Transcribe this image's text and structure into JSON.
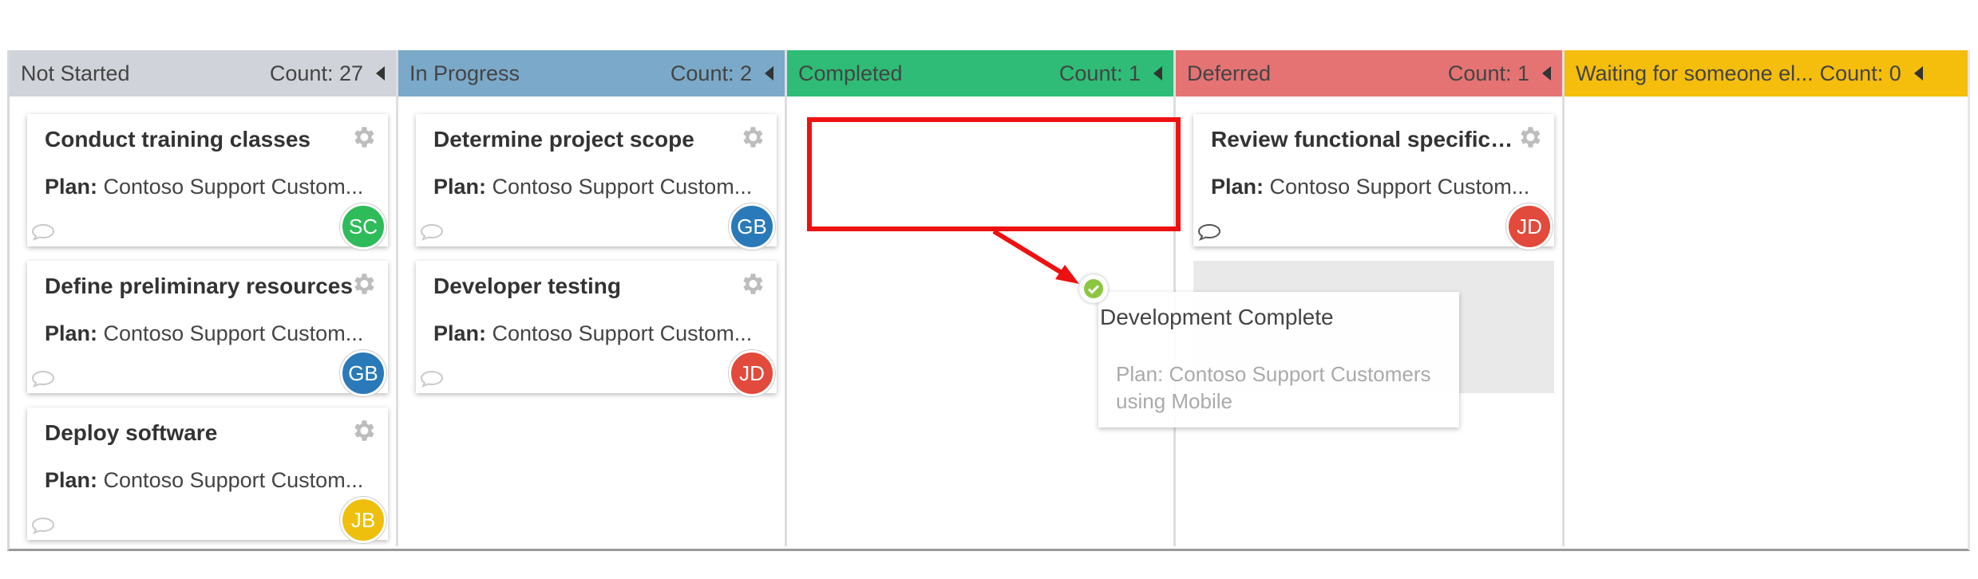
{
  "columns": [
    {
      "title": "Not Started",
      "count": "Count: 27",
      "color": "#d0d3da"
    },
    {
      "title": "In Progress",
      "count": "Count: 2",
      "color": "#7ba9c9"
    },
    {
      "title": "Completed",
      "count": "Count: 1",
      "color": "#2ebc76"
    },
    {
      "title": "Deferred",
      "count": "Count: 1",
      "color": "#e57373"
    },
    {
      "title": "Waiting for someone el...",
      "count": "Count: 0",
      "color": "#f5bd0c"
    }
  ],
  "plan_label": "Plan:",
  "cards": {
    "not_started": [
      {
        "title": "Conduct training classes",
        "plan": "Contoso Support Custom...",
        "assignee": "SC",
        "assignee_color": "#2ebc5a"
      },
      {
        "title": "Define preliminary resources",
        "plan": "Contoso Support Custom...",
        "assignee": "GB",
        "assignee_color": "#2a7ab9"
      },
      {
        "title": "Deploy software",
        "plan": "Contoso Support Custom...",
        "assignee": "JB",
        "assignee_color": "#efbf0e"
      }
    ],
    "in_progress": [
      {
        "title": "Determine project scope",
        "plan": "Contoso Support Custom...",
        "assignee": "GB",
        "assignee_color": "#2a7ab9"
      },
      {
        "title": "Developer testing",
        "plan": "Contoso Support Custom...",
        "assignee": "JD",
        "assignee_color": "#e24a3b"
      }
    ],
    "deferred": [
      {
        "title": "Review functional specifica...",
        "plan": "Contoso Support Custom...",
        "assignee": "JD",
        "assignee_color": "#e24a3b"
      }
    ]
  },
  "dragging_card": {
    "title": "Development Complete",
    "plan_label": "Plan:",
    "plan": "Contoso Support Customers using Mobile",
    "check_color": "#8cc63f"
  },
  "annotation_color": "#ee1111"
}
